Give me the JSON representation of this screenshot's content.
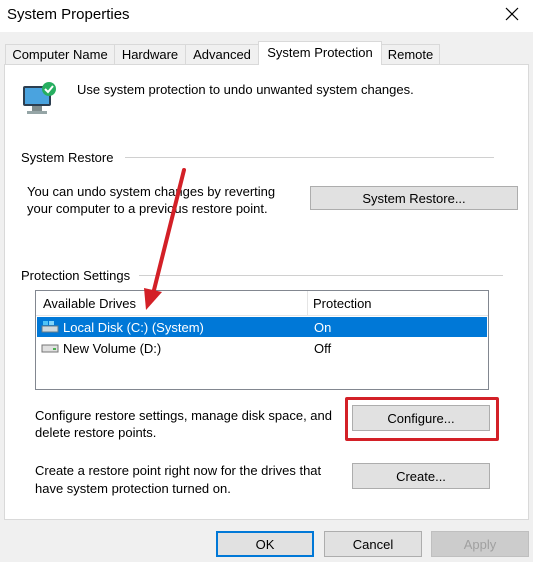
{
  "window": {
    "title": "System Properties"
  },
  "tabs": [
    {
      "label": "Computer Name"
    },
    {
      "label": "Hardware"
    },
    {
      "label": "Advanced"
    },
    {
      "label": "System Protection"
    },
    {
      "label": "Remote"
    }
  ],
  "protection": {
    "intro": "Use system protection to undo unwanted system changes."
  },
  "system_restore": {
    "heading": "System Restore",
    "desc_line1": "You can undo system changes by reverting",
    "desc_line2": "your computer to a previous restore point.",
    "button": "System Restore..."
  },
  "protection_settings": {
    "heading": "Protection Settings",
    "columns": [
      "Available Drives",
      "Protection"
    ],
    "drives": [
      {
        "name": "Local Disk (C:) (System)",
        "protection": "On",
        "selected": true,
        "icon": "system-drive-icon"
      },
      {
        "name": "New Volume (D:)",
        "protection": "Off",
        "selected": false,
        "icon": "drive-icon"
      }
    ],
    "configure_line1": "Configure restore settings, manage disk space, and",
    "configure_line2": "delete restore points.",
    "configure_button": "Configure...",
    "create_line1": "Create a restore point right now for the drives that",
    "create_line2": "have system protection turned on.",
    "create_button": "Create..."
  },
  "footer": {
    "ok": "OK",
    "cancel": "Cancel",
    "apply": "Apply"
  },
  "colors": {
    "selection": "#0078d7",
    "highlight": "#d32027"
  }
}
